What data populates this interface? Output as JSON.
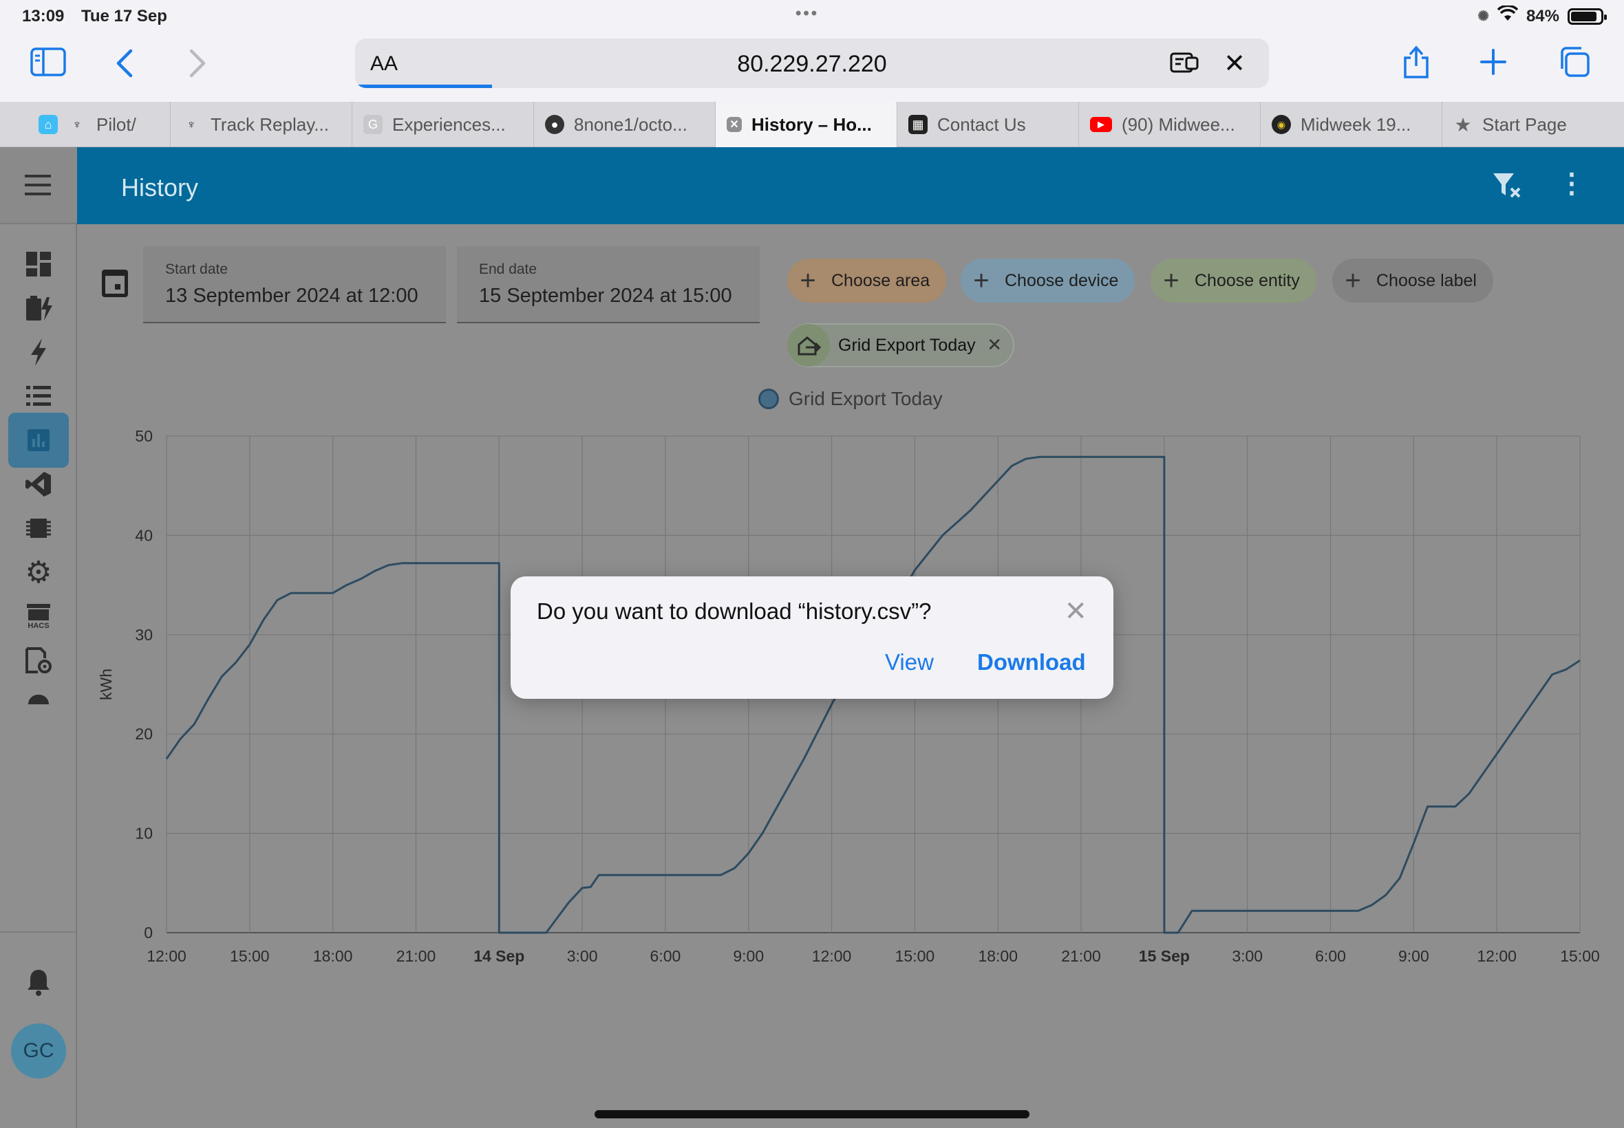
{
  "status_bar": {
    "time": "13:09",
    "date": "Tue 17 Sep",
    "battery_percent": "84%",
    "battery_level": 0.84
  },
  "browser": {
    "aa_label": "AA",
    "url": "80.229.27.220",
    "load_progress": 0.15,
    "icons": [
      "sidebar-icon",
      "back-icon",
      "forward-icon",
      "reader-icon",
      "stop-icon",
      "share-icon",
      "new-tab-icon",
      "tabs-overview-icon"
    ],
    "tabs": [
      {
        "label": "Pilot/",
        "icon": "antenna-icon"
      },
      {
        "label": "Track Replay...",
        "icon": "antenna-icon"
      },
      {
        "label": "Experiences...",
        "icon": "g-icon"
      },
      {
        "label": "8none1/octo...",
        "icon": "github-icon"
      },
      {
        "label": "History – Ho...",
        "icon": "close-tab-icon",
        "active": true
      },
      {
        "label": "Contact Us",
        "icon": "train-icon"
      },
      {
        "label": "(90) Midwee...",
        "icon": "youtube-icon"
      },
      {
        "label": "Midweek 19...",
        "icon": "podcast-icon"
      },
      {
        "label": "Start Page",
        "icon": "star-icon"
      }
    ]
  },
  "app": {
    "title": "History",
    "sidebar_items": [
      "dashboard-icon",
      "energy-icon",
      "lightning-icon",
      "logbook-icon",
      "history-icon",
      "vscode-icon",
      "chip-icon",
      "settings-icon",
      "hacs-icon",
      "settings-file-icon"
    ],
    "hacs_label": "HACS",
    "notifications_icon": "bell-icon",
    "avatar_initials": "GC",
    "start_date": {
      "label": "Start date",
      "value": "13 September 2024 at 12:00"
    },
    "end_date": {
      "label": "End date",
      "value": "15 September 2024 at 15:00"
    },
    "chips": {
      "area": "Choose area",
      "device": "Choose device",
      "entity": "Choose entity",
      "label": "Choose label"
    },
    "selected_entity": "Grid Export Today",
    "colors": {
      "header": "#03699b",
      "series": "#2d4b61",
      "accent": "#1a7ae8"
    }
  },
  "chart_data": {
    "type": "line",
    "title": "",
    "ylabel": "kWh",
    "xlabel": "",
    "ylim": [
      0,
      50
    ],
    "y_ticks": [
      "0",
      "10",
      "20",
      "30",
      "40",
      "50"
    ],
    "x_ticks": [
      "12:00",
      "15:00",
      "18:00",
      "21:00",
      "14 Sep",
      "3:00",
      "6:00",
      "9:00",
      "12:00",
      "15:00",
      "18:00",
      "21:00",
      "15 Sep",
      "3:00",
      "6:00",
      "9:00",
      "12:00",
      "15:00"
    ],
    "x_tick_bold": [
      "14 Sep",
      "15 Sep"
    ],
    "xlim_hours": [
      0,
      51
    ],
    "legend": "top-center",
    "grid": true,
    "series": [
      {
        "name": "Grid Export Today",
        "points": [
          [
            0,
            17.5
          ],
          [
            0.5,
            19.5
          ],
          [
            1,
            21
          ],
          [
            1.5,
            23.5
          ],
          [
            2,
            25.8
          ],
          [
            2.5,
            27.2
          ],
          [
            3,
            29
          ],
          [
            3.5,
            31.5
          ],
          [
            4,
            33.5
          ],
          [
            4.5,
            34.2
          ],
          [
            5,
            34.2
          ],
          [
            5.5,
            34.2
          ],
          [
            6,
            34.2
          ],
          [
            6.5,
            35
          ],
          [
            7,
            35.6
          ],
          [
            7.5,
            36.4
          ],
          [
            8,
            37
          ],
          [
            8.5,
            37.2
          ],
          [
            11,
            37.2
          ],
          [
            12,
            37.2
          ],
          [
            12,
            0
          ],
          [
            13.7,
            0
          ],
          [
            14.5,
            3
          ],
          [
            15,
            4.5
          ],
          [
            15.3,
            4.6
          ],
          [
            15.6,
            5.8
          ],
          [
            19,
            5.8
          ],
          [
            20,
            5.8
          ],
          [
            20.5,
            6.5
          ],
          [
            21,
            8
          ],
          [
            21.5,
            10
          ],
          [
            22,
            12.5
          ],
          [
            23,
            17.5
          ],
          [
            24,
            23
          ],
          [
            24.5,
            25.5
          ],
          [
            25,
            28
          ],
          [
            26,
            31.5
          ],
          [
            27,
            36.5
          ],
          [
            28,
            40
          ],
          [
            29,
            42.5
          ],
          [
            30,
            45.5
          ],
          [
            30.5,
            47
          ],
          [
            31,
            47.7
          ],
          [
            31.5,
            47.9
          ],
          [
            36,
            47.9
          ],
          [
            36,
            0
          ],
          [
            36.5,
            0
          ],
          [
            37,
            2.2
          ],
          [
            38,
            2.2
          ],
          [
            42,
            2.2
          ],
          [
            43,
            2.2
          ],
          [
            43.5,
            2.8
          ],
          [
            44,
            3.8
          ],
          [
            44.5,
            5.5
          ],
          [
            45,
            9
          ],
          [
            45.5,
            12.7
          ],
          [
            46,
            12.7
          ],
          [
            46.5,
            12.7
          ],
          [
            47,
            14
          ],
          [
            47.5,
            16
          ],
          [
            48,
            18
          ],
          [
            48.5,
            20
          ],
          [
            49,
            22
          ],
          [
            49.5,
            24
          ],
          [
            50,
            26
          ],
          [
            50.5,
            26.5
          ],
          [
            51,
            27.4
          ]
        ]
      }
    ]
  },
  "dialog": {
    "message": "Do you want to download “history.csv”?",
    "view_label": "View",
    "download_label": "Download"
  }
}
